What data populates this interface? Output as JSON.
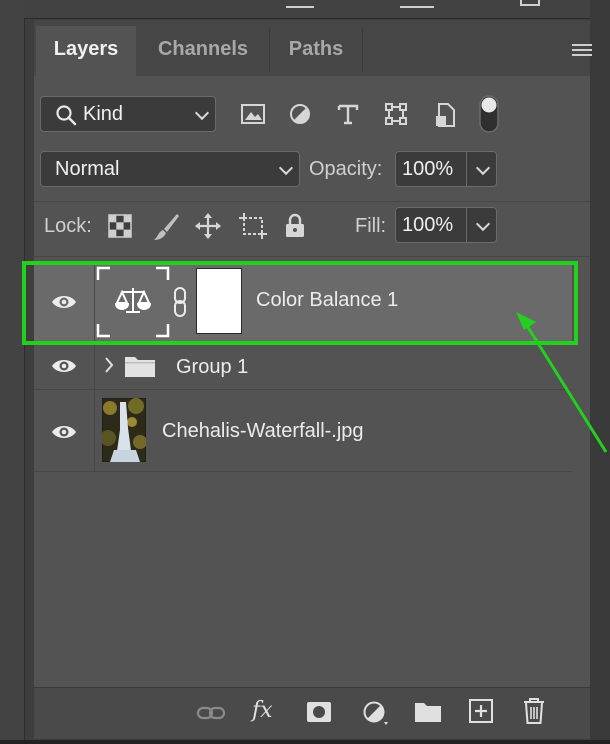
{
  "tabs": [
    {
      "label": "Layers",
      "active": true
    },
    {
      "label": "Channels",
      "active": false
    },
    {
      "label": "Paths",
      "active": false
    }
  ],
  "filter": {
    "kind_label": "Kind",
    "icons": [
      "image-filter-icon",
      "adjustment-filter-icon",
      "type-filter-icon",
      "shape-filter-icon",
      "smart-object-filter-icon",
      "filter-toggle-icon"
    ]
  },
  "blend": {
    "mode": "Normal",
    "opacity_label": "Opacity:",
    "opacity_value": "100%"
  },
  "lock": {
    "label": "Lock:",
    "icons": [
      "lock-transparent-pixels-icon",
      "lock-image-pixels-icon",
      "lock-position-icon",
      "lock-artboard-icon",
      "lock-all-icon"
    ],
    "fill_label": "Fill:",
    "fill_value": "100%"
  },
  "layers": [
    {
      "name": "Color Balance 1",
      "type": "adjustment",
      "visible": true,
      "selected": true
    },
    {
      "name": "Group 1",
      "type": "group",
      "visible": true,
      "selected": false
    },
    {
      "name": "Chehalis-Waterfall-.jpg",
      "type": "image",
      "visible": true,
      "selected": false
    }
  ],
  "footer": {
    "fx_label": "fx",
    "icons": [
      "link-layers-icon",
      "fx-icon",
      "add-mask-icon",
      "new-adjustment-icon",
      "new-group-icon",
      "new-layer-icon",
      "delete-layer-icon"
    ]
  },
  "colors": {
    "highlight": "#22d11d",
    "panel": "#535353",
    "selected_row": "#6a6a6a"
  }
}
